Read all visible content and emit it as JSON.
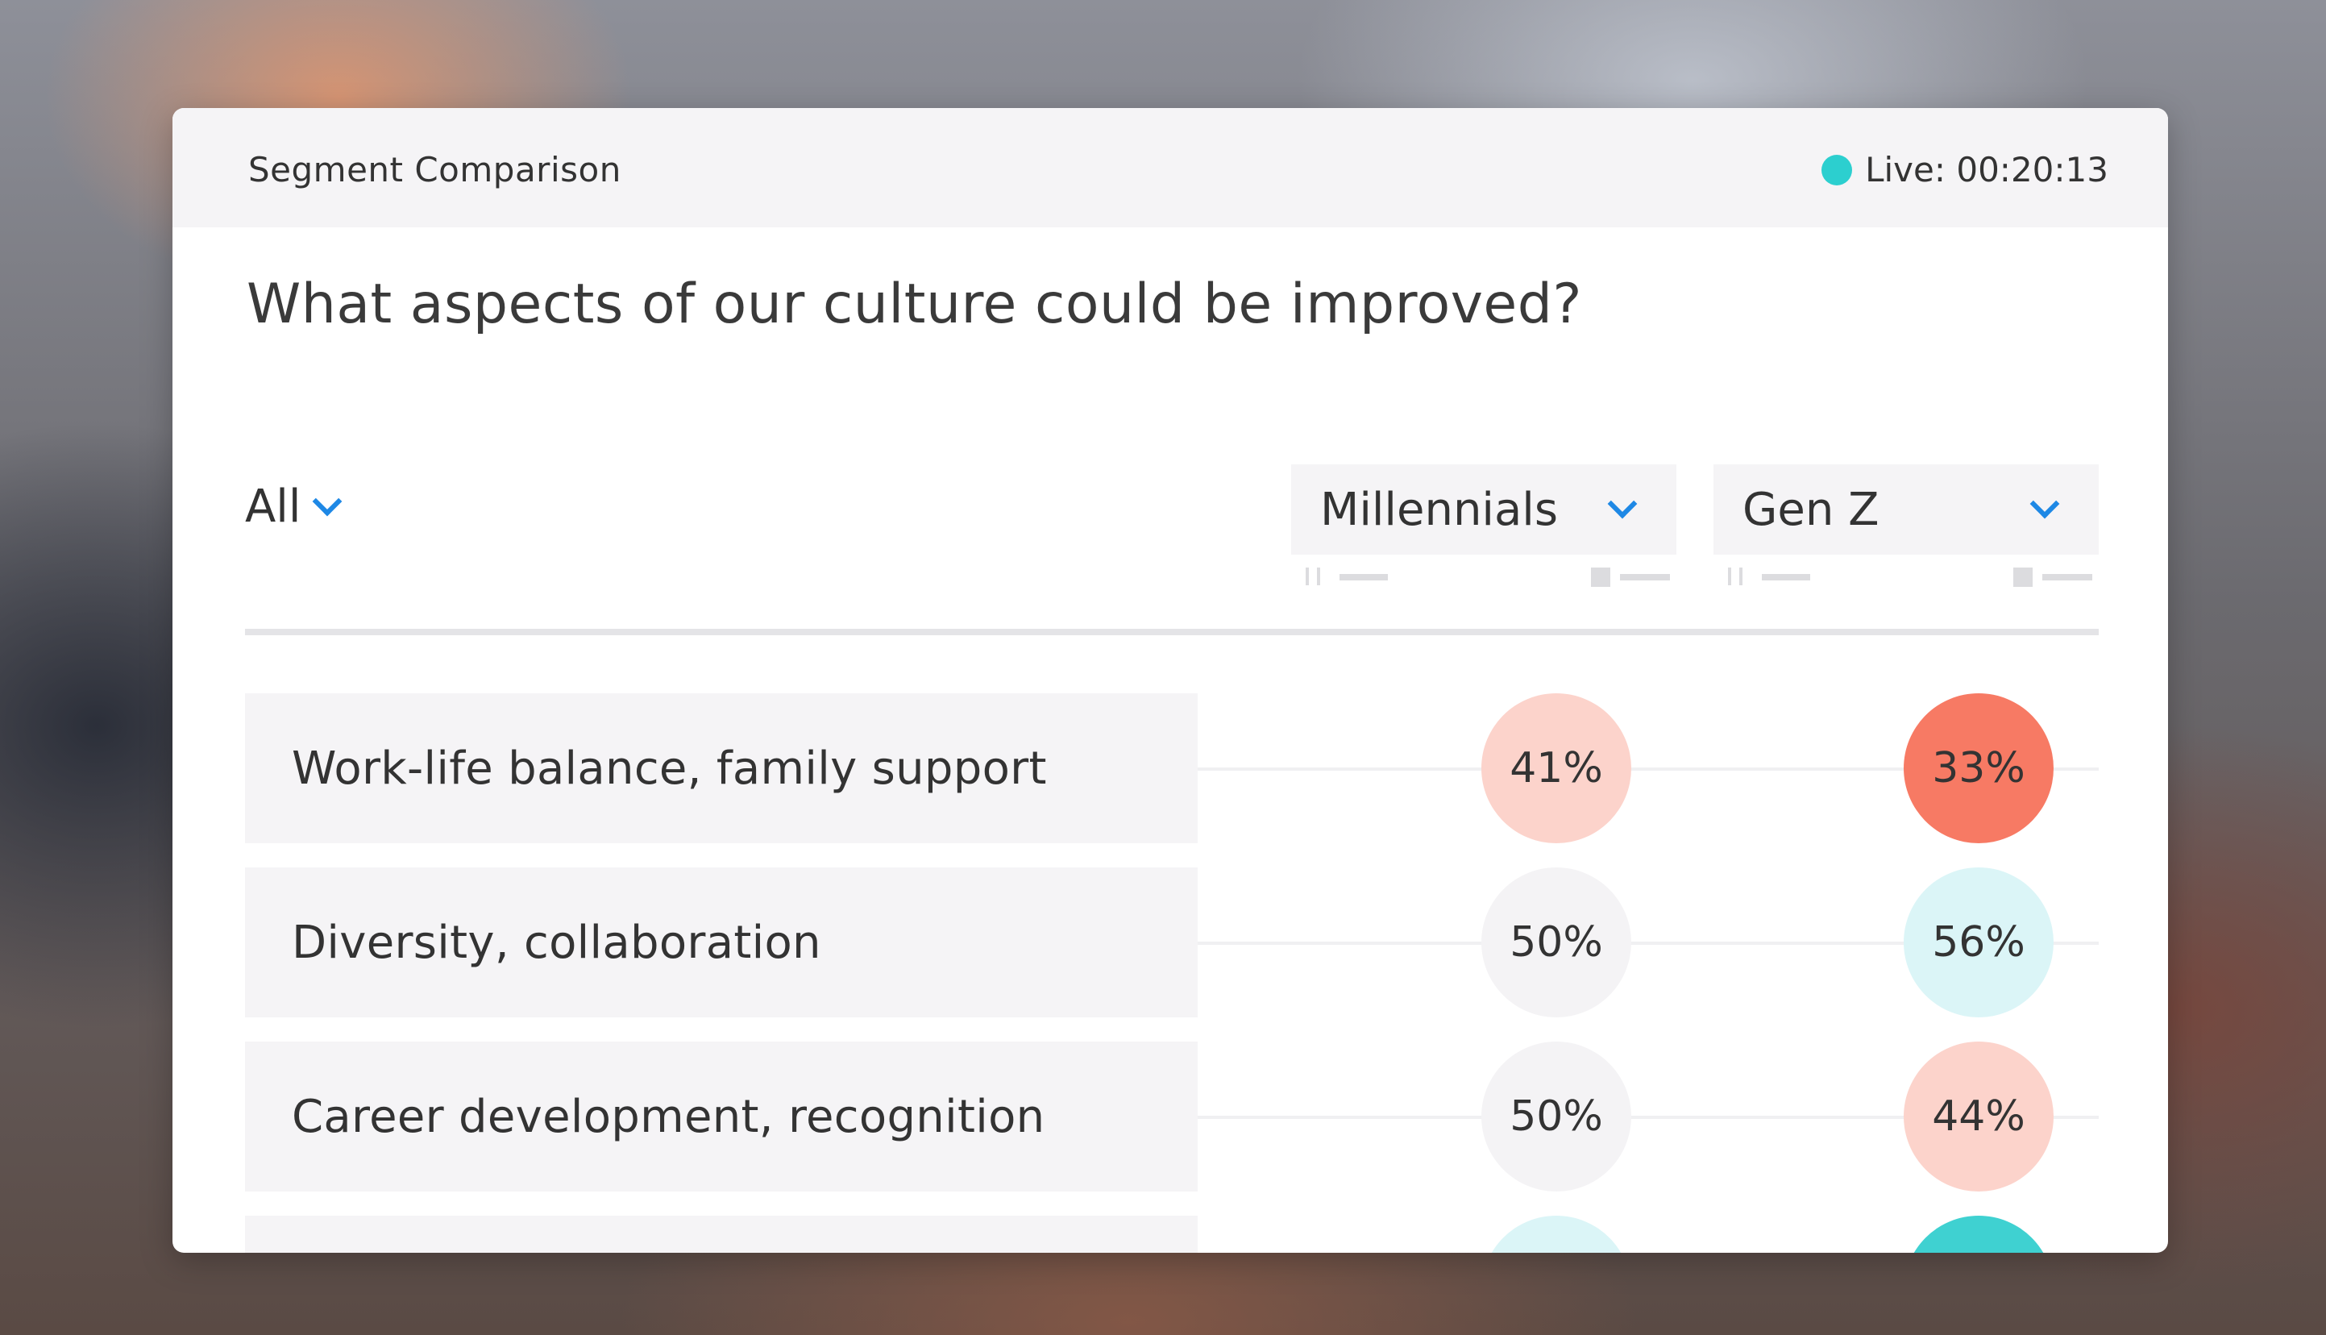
{
  "header": {
    "title": "Segment Comparison",
    "live_label": "Live: 00:20:13",
    "live_color": "#2ccfcf"
  },
  "question": "What aspects of our culture could be improved?",
  "filter": {
    "label": "All"
  },
  "segments": [
    {
      "label": "Millennials"
    },
    {
      "label": "Gen Z"
    }
  ],
  "rows": [
    {
      "label": "Work-life balance, family support",
      "millennials": {
        "value": "41%",
        "color": "#fcd3cb"
      },
      "genz": {
        "value": "33%",
        "color": "#f77a64"
      }
    },
    {
      "label": "Diversity, collaboration",
      "millennials": {
        "value": "50%",
        "color": "#f4f3f5"
      },
      "genz": {
        "value": "56%",
        "color": "#dbf5f7"
      }
    },
    {
      "label": "Career development, recognition",
      "millennials": {
        "value": "50%",
        "color": "#f4f3f5"
      },
      "genz": {
        "value": "44%",
        "color": "#fcd3cb"
      }
    },
    {
      "label": "",
      "millennials": {
        "value": "",
        "color": "#dbf5f7"
      },
      "genz": {
        "value": "",
        "color": "#3fd1d1"
      }
    }
  ],
  "icons": {
    "chevron": "chevron-down-icon",
    "live": "live-dot-icon"
  }
}
